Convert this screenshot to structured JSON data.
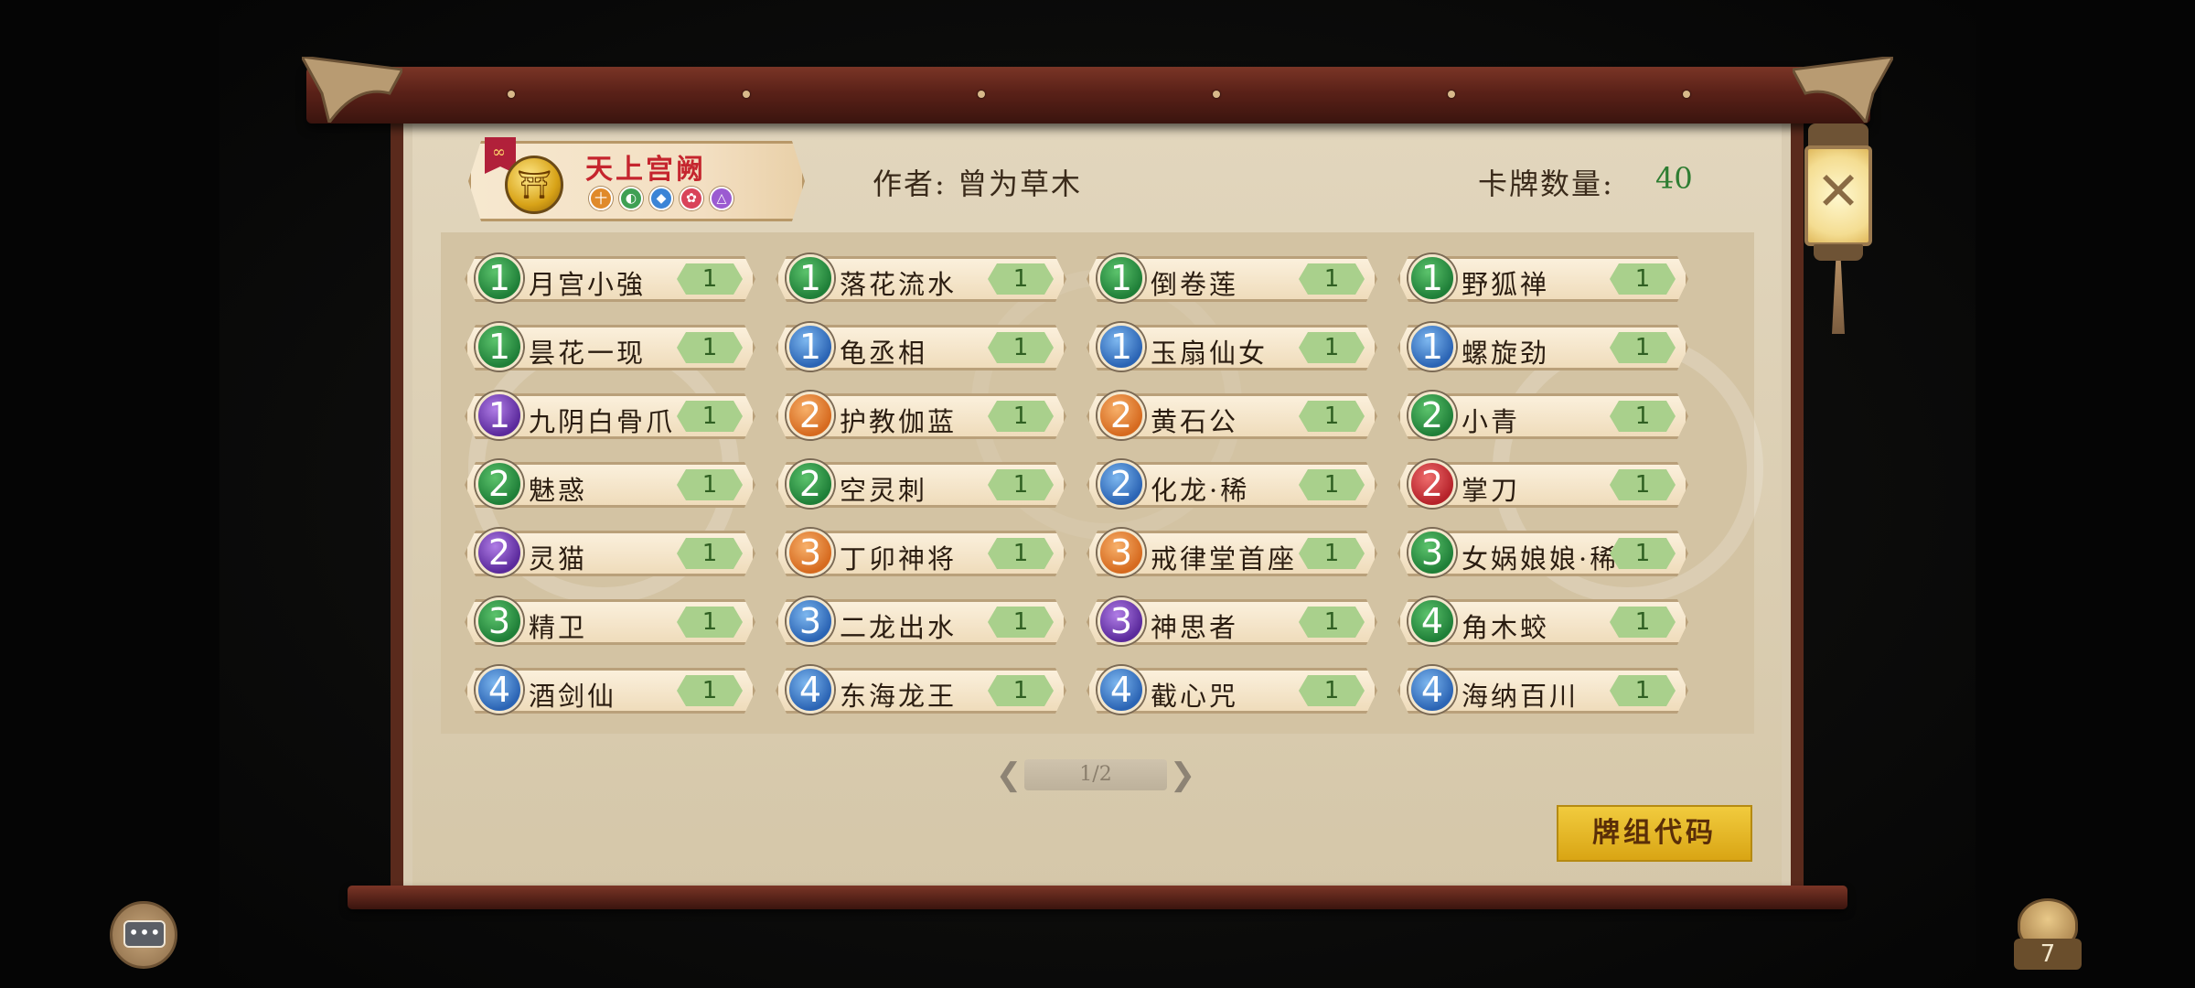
{
  "deck": {
    "name": "天上宫阙",
    "elements": [
      {
        "icon": "earth-icon",
        "symbol": "十",
        "color": "#e08a2a"
      },
      {
        "icon": "wood-icon",
        "symbol": "◐",
        "color": "#3fa054"
      },
      {
        "icon": "water-icon",
        "symbol": "◆",
        "color": "#3b84d6"
      },
      {
        "icon": "fire-icon",
        "symbol": "✿",
        "color": "#d9435a"
      },
      {
        "icon": "metal-icon",
        "symbol": "△",
        "color": "#9b5bd1"
      }
    ]
  },
  "author": "作者: 曾为草木",
  "card_count_label": "卡牌数量:",
  "card_count_value": "40",
  "cards": [
    {
      "cost": "1",
      "color": "green",
      "name": "月宫小強",
      "qty": "1"
    },
    {
      "cost": "1",
      "color": "green",
      "name": "落花流水",
      "qty": "1"
    },
    {
      "cost": "1",
      "color": "green",
      "name": "倒卷莲",
      "qty": "1"
    },
    {
      "cost": "1",
      "color": "green",
      "name": "野狐禅",
      "qty": "1"
    },
    {
      "cost": "1",
      "color": "green",
      "name": "昙花一现",
      "qty": "1"
    },
    {
      "cost": "1",
      "color": "blue",
      "name": "龟丞相",
      "qty": "1"
    },
    {
      "cost": "1",
      "color": "blue",
      "name": "玉扇仙女",
      "qty": "1"
    },
    {
      "cost": "1",
      "color": "blue",
      "name": "螺旋劲",
      "qty": "1"
    },
    {
      "cost": "1",
      "color": "purple",
      "name": "九阴白骨爪",
      "qty": "1"
    },
    {
      "cost": "2",
      "color": "orange",
      "name": "护教伽蓝",
      "qty": "1"
    },
    {
      "cost": "2",
      "color": "orange",
      "name": "黄石公",
      "qty": "1"
    },
    {
      "cost": "2",
      "color": "green",
      "name": "小青",
      "qty": "1"
    },
    {
      "cost": "2",
      "color": "green",
      "name": "魅惑",
      "qty": "1"
    },
    {
      "cost": "2",
      "color": "green",
      "name": "空灵刺",
      "qty": "1"
    },
    {
      "cost": "2",
      "color": "blue",
      "name": "化龙·稀",
      "qty": "1"
    },
    {
      "cost": "2",
      "color": "red",
      "name": "掌刀",
      "qty": "1"
    },
    {
      "cost": "2",
      "color": "purple",
      "name": "灵猫",
      "qty": "1"
    },
    {
      "cost": "3",
      "color": "orange",
      "name": "丁卯神将",
      "qty": "1"
    },
    {
      "cost": "3",
      "color": "orange",
      "name": "戒律堂首座",
      "qty": "1"
    },
    {
      "cost": "3",
      "color": "green",
      "name": "女娲娘娘·稀",
      "qty": "1"
    },
    {
      "cost": "3",
      "color": "green",
      "name": "精卫",
      "qty": "1"
    },
    {
      "cost": "3",
      "color": "blue",
      "name": "二龙出水",
      "qty": "1"
    },
    {
      "cost": "3",
      "color": "purple",
      "name": "神思者",
      "qty": "1"
    },
    {
      "cost": "4",
      "color": "green",
      "name": "角木蛟",
      "qty": "1"
    },
    {
      "cost": "4",
      "color": "blue",
      "name": "酒剑仙",
      "qty": "1"
    },
    {
      "cost": "4",
      "color": "blue",
      "name": "东海龙王",
      "qty": "1"
    },
    {
      "cost": "4",
      "color": "blue",
      "name": "截心咒",
      "qty": "1"
    },
    {
      "cost": "4",
      "color": "blue",
      "name": "海纳百川",
      "qty": "1"
    }
  ],
  "pager": {
    "text": "1/2",
    "prev_icon": "chevron-left-icon",
    "next_icon": "chevron-right-icon"
  },
  "deck_code_button": "牌组代码",
  "close_icon": "close-icon",
  "chat_icon": "chat-icon",
  "bag_count": "7"
}
